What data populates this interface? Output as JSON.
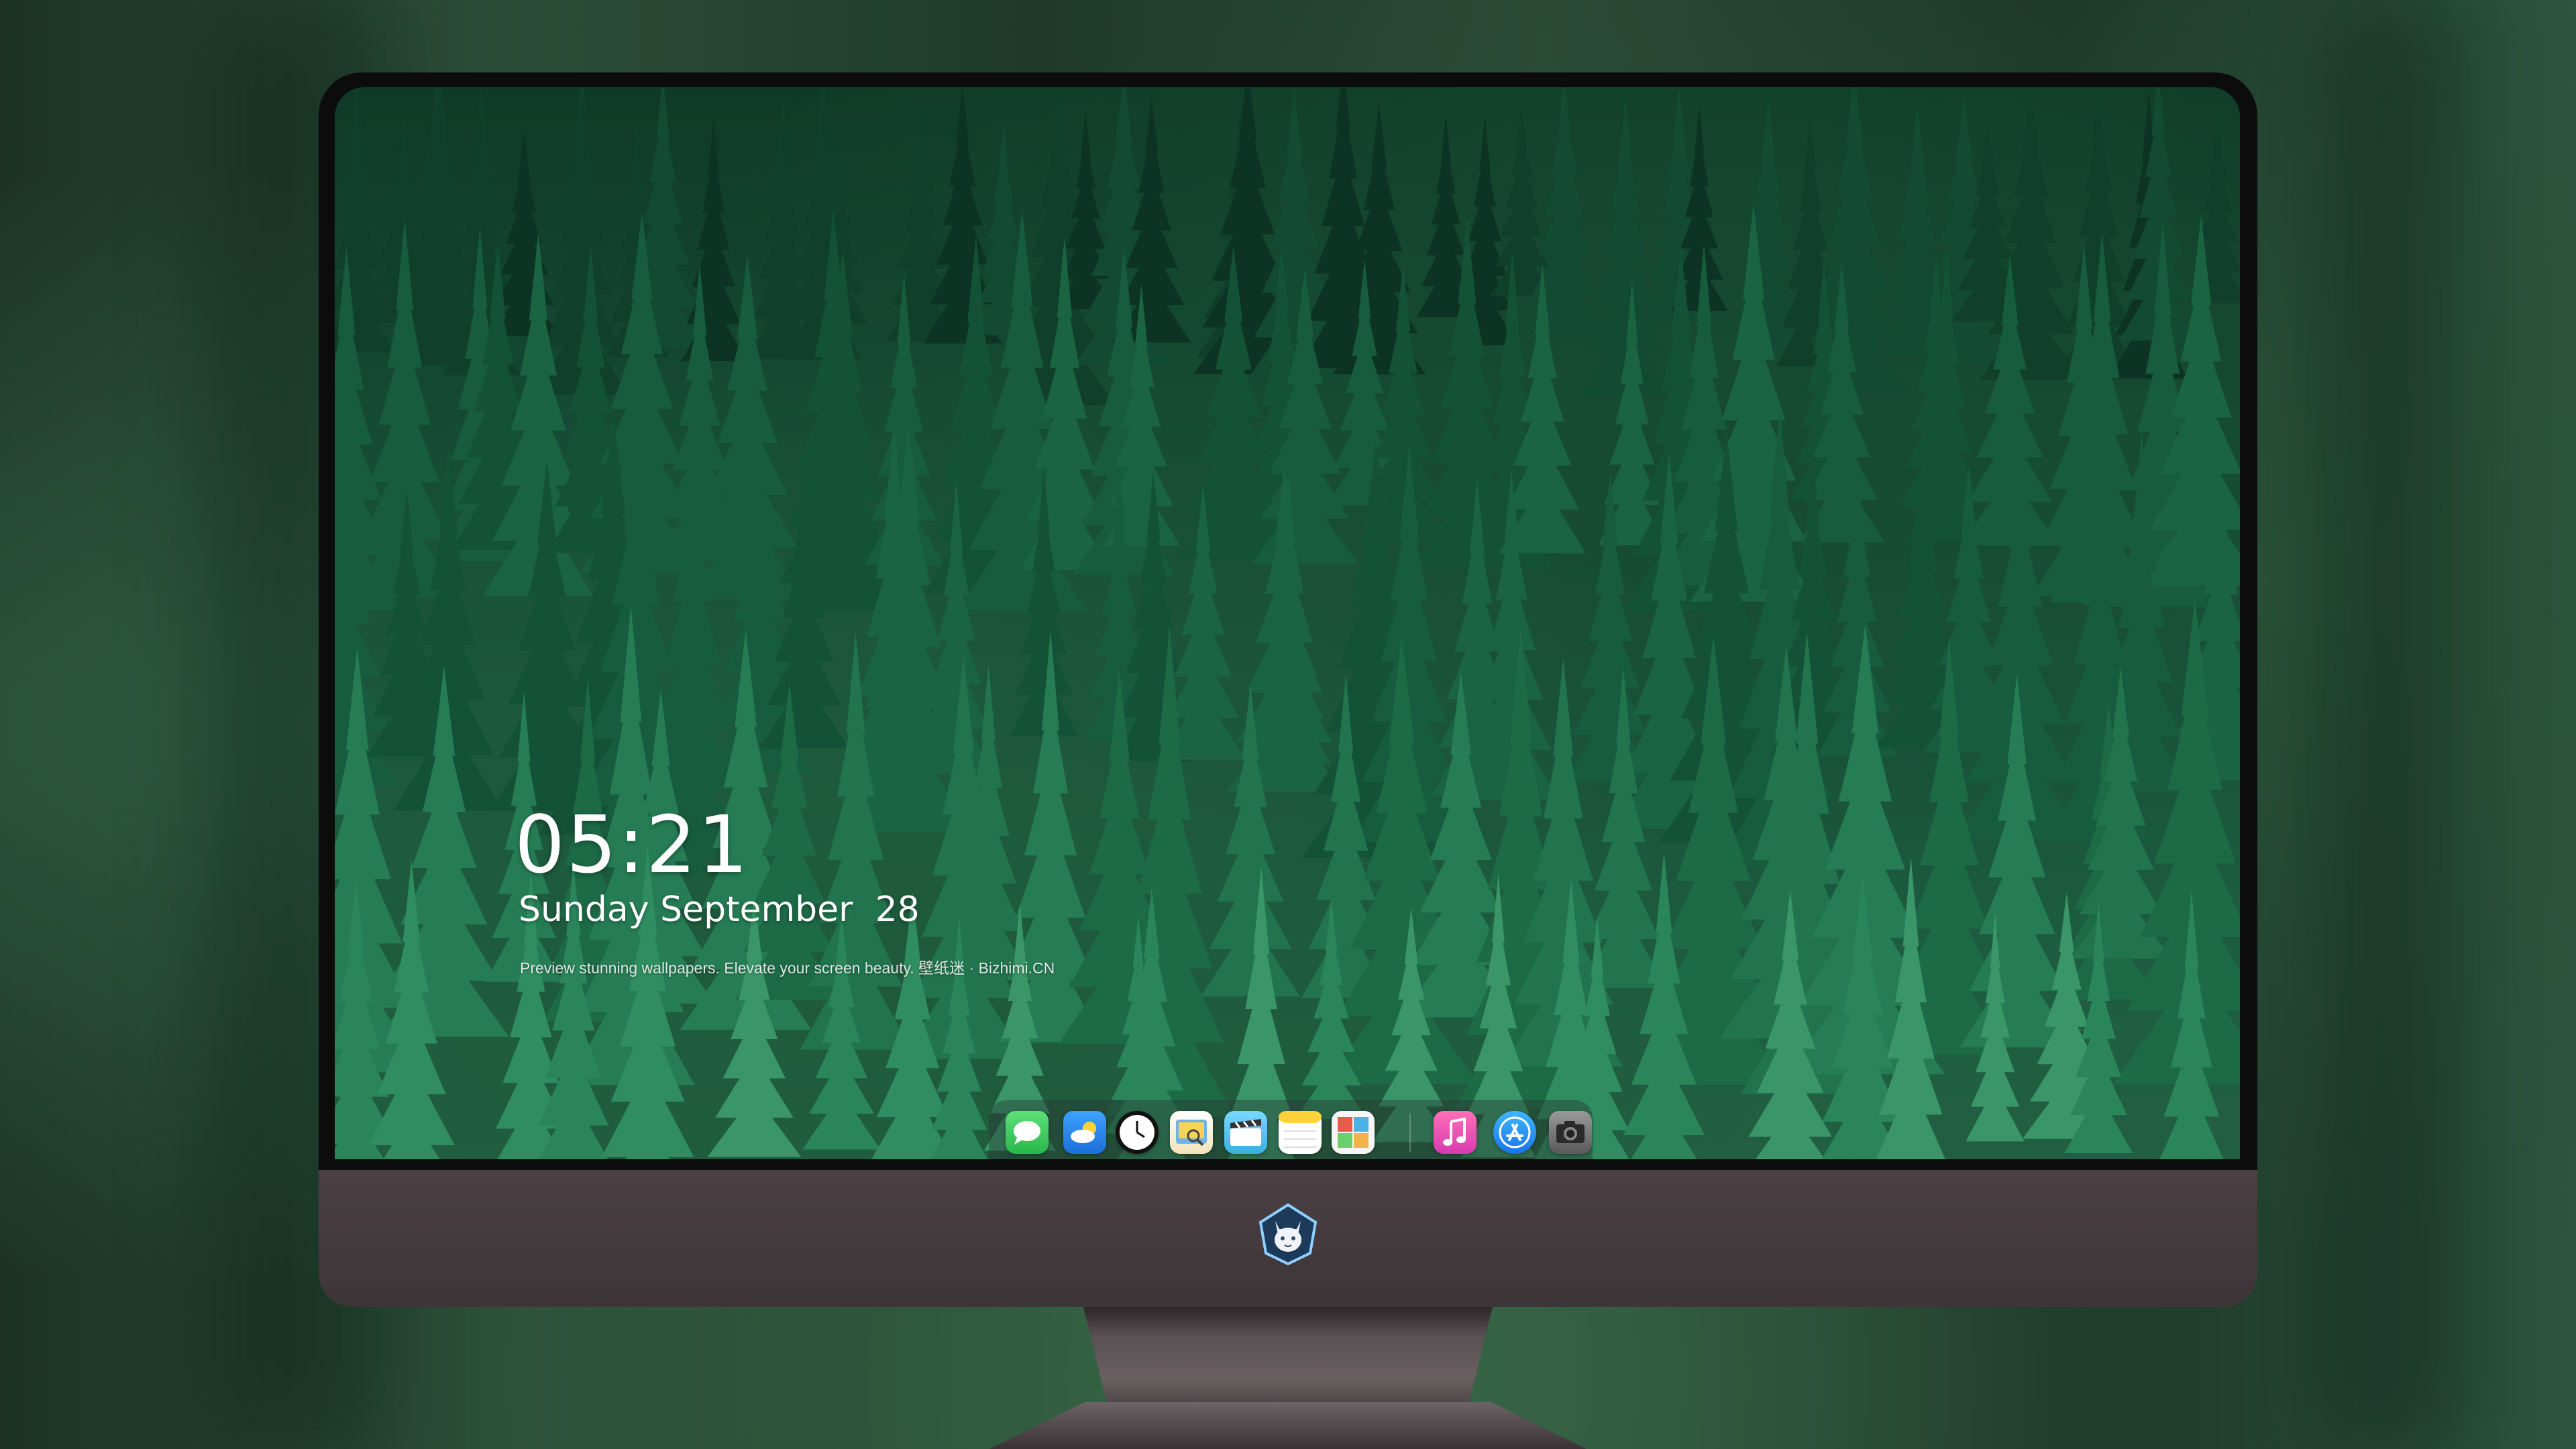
{
  "lock_screen": {
    "time": "05:21",
    "date": "Sunday September  28",
    "tagline": "Preview stunning wallpapers. Elevate your screen beauty. 壁纸迷 · Bizhimi.CN"
  },
  "dock": {
    "items": [
      {
        "name": "messages-icon",
        "color": "#34c759"
      },
      {
        "name": "weather-icon",
        "color": "#2f8ff0"
      },
      {
        "name": "clock-icon",
        "color": "#ffffff"
      },
      {
        "name": "preview-icon",
        "color": "#f2c14a"
      },
      {
        "name": "clips-icon",
        "color": "#5ec8f0"
      },
      {
        "name": "notes-icon",
        "color": "#ffd84a"
      },
      {
        "name": "photo-booth-icon",
        "color": "#f0b24a"
      },
      {
        "name": "music-icon",
        "color": "#f04a9a"
      },
      {
        "name": "app-store-icon",
        "color": "#1c8ef9"
      },
      {
        "name": "camera-icon",
        "color": "#8a8a8a"
      }
    ]
  },
  "chin_logo": {
    "name": "cat-mascot-logo",
    "color": "#8fd0ff"
  }
}
